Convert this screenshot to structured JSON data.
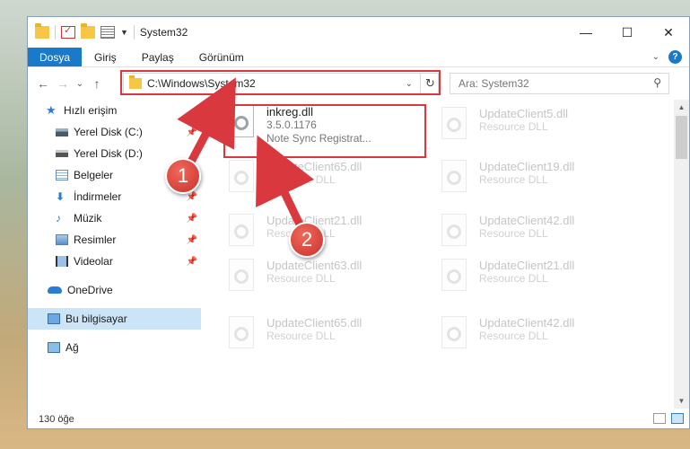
{
  "window": {
    "title": "System32",
    "controls": {
      "minimize": "—",
      "maximize": "☐",
      "close": "✕"
    }
  },
  "ribbon": {
    "tabs": [
      "Dosya",
      "Giriş",
      "Paylaş",
      "Görünüm"
    ]
  },
  "nav": {
    "back": "←",
    "forward": "→",
    "recent": "⌄",
    "up": "↑",
    "address": "C:\\Windows\\System32",
    "refresh": "↻",
    "search_placeholder": "Ara: System32"
  },
  "sidebar": {
    "items": [
      {
        "label": "Hızlı erişim",
        "icon": "star-icon"
      },
      {
        "label": "Yerel Disk (C:)",
        "icon": "drive-icon",
        "pinned": true
      },
      {
        "label": "Yerel Disk (D:)",
        "icon": "drive-icon"
      },
      {
        "label": "Belgeler",
        "icon": "documents-icon",
        "pinned": true
      },
      {
        "label": "İndirmeler",
        "icon": "download-icon",
        "pinned": true
      },
      {
        "label": "Müzik",
        "icon": "music-icon",
        "pinned": true
      },
      {
        "label": "Resimler",
        "icon": "pictures-icon",
        "pinned": true
      },
      {
        "label": "Videolar",
        "icon": "videos-icon",
        "pinned": true
      },
      {
        "label": "OneDrive",
        "icon": "cloud-icon"
      },
      {
        "label": "Bu bilgisayar",
        "icon": "computer-icon",
        "selected": true
      },
      {
        "label": "Ağ",
        "icon": "network-icon"
      }
    ]
  },
  "files": [
    {
      "name": "inkreg.dll",
      "version": "3.5.0.1176",
      "desc": "Note Sync Registrat..."
    },
    {
      "name": "UpdateClient5.dll",
      "desc": "Resource DLL"
    },
    {
      "name": "UpdateClient65.dll",
      "desc": "Resource DLL"
    },
    {
      "name": "UpdateClient19.dll",
      "desc": "Resource DLL"
    },
    {
      "name": "UpdateClient21.dll",
      "desc": "Resource DLL"
    },
    {
      "name": "UpdateClient42.dll",
      "desc": "Resource DLL"
    },
    {
      "name": "UpdateClient63.dll",
      "desc": "Resource DLL"
    },
    {
      "name": "UpdateClient21.dll",
      "desc": "Resource DLL"
    },
    {
      "name": "UpdateClient65.dll",
      "desc": "Resource DLL"
    },
    {
      "name": "UpdateClient42.dll",
      "desc": "Resource DLL"
    }
  ],
  "status": {
    "count": "130 öğe"
  },
  "annotations": {
    "step1": "1",
    "step2": "2",
    "color": "#d9393e"
  }
}
